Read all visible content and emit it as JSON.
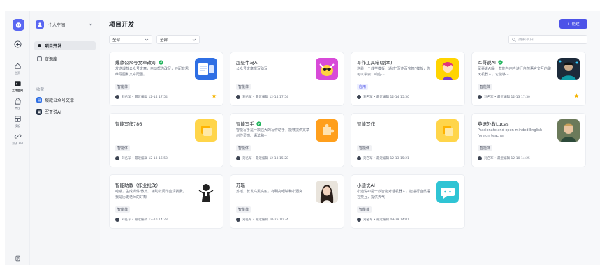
{
  "colors": {
    "brand": "#4d53e8",
    "accent_logo": "#5a67f2",
    "star": "#f5b400",
    "verified": "#1fb45a"
  },
  "rail": {
    "items": [
      {
        "label": "",
        "icon": "plus-circle-icon"
      },
      {
        "label": "主页",
        "icon": "home-icon"
      },
      {
        "label": "工作空间",
        "icon": "folder-icon",
        "active": true
      },
      {
        "label": "商店",
        "icon": "store-icon"
      },
      {
        "label": "模板",
        "icon": "template-icon"
      },
      {
        "label": "扣子 API",
        "icon": "link-icon"
      }
    ]
  },
  "workspace": {
    "name": "个人空间"
  },
  "sidebar": {
    "items": [
      {
        "label": "项目开发",
        "active": true
      },
      {
        "label": "资源库"
      }
    ],
    "group_label": "收藏",
    "favorites": [
      {
        "label": "爆款公众号文章···"
      },
      {
        "label": "军哥说AI"
      }
    ]
  },
  "main": {
    "title": "项目开发",
    "create_label": "+ 创建",
    "filters": [
      {
        "value": "全部"
      },
      {
        "value": "全部"
      }
    ],
    "search_placeholder": "搜索项目"
  },
  "cards": [
    {
      "title": "爆款公众号文章改写",
      "verified": true,
      "desc": "发送爆款公众号文章，自动帮你改写，还配有思维导图和文章配图。",
      "tag": "智能体",
      "meta": "刘名军 • 最近编辑 12-14 17:54",
      "thumb": "doc-thumb",
      "starred": true
    },
    {
      "title": "超级牛马AI",
      "verified": false,
      "desc": "公众号文章撰写助写",
      "tag": "智能体",
      "meta": "刘名军 • 最近编辑 12-14 17:54",
      "thumb": "ox-thumb",
      "starred": false
    },
    {
      "title": "写作工具箱(副本)",
      "verified": false,
      "desc": "这是一个教学模板，通过“写作百宝箱”模板，你可以学会：响应···",
      "tag": "应用",
      "tag_style": "blue",
      "meta": "刘名军 • 最近编辑 12-14 15:50",
      "thumb": "anime-thumb",
      "starred": false
    },
    {
      "title": "军哥说AI",
      "verified": true,
      "desc": "军哥说AI是一款能与用户进行自然语言交互的聊天机器人。它能够···",
      "tag": "智能体",
      "meta": "刘名军 • 最近编辑 12-13 17:30",
      "thumb": "portrait-thumb",
      "starred": true
    },
    {
      "title": "智能写作786",
      "verified": false,
      "desc": "",
      "tag": "智能体",
      "meta": "刘名军 • 最近编辑 12-13 16:53",
      "thumb": "yellow-square-thumb",
      "starred": false
    },
    {
      "title": "智能写手",
      "verified": true,
      "desc": "智能写手是一款强大的写作助手，能够提供文章创作灵感、语法和···",
      "tag": "智能体",
      "meta": "刘名军 • 最近编辑 12-13 15:28",
      "thumb": "orange-puzzle-thumb",
      "starred": false
    },
    {
      "title": "智能写作",
      "verified": false,
      "desc": "",
      "tag": "智能体",
      "meta": "刘名军 • 最近编辑 12-13 15:21",
      "thumb": "yellow-square-thumb",
      "starred": false
    },
    {
      "title": "英语外教Lucas",
      "verified": false,
      "desc": "Passionate and open-minded English foreign teacher",
      "tag": "智能体",
      "meta": "刘名军 • 最近编辑 12-10 14:25",
      "thumb": "man-thumb",
      "starred": false
    },
    {
      "title": "智能助教（作业批改）",
      "verified": false,
      "desc": "哈喽，生成课件/教案、辅助批阅作业请找我，我是历史老师的好帮···",
      "tag": "智能体",
      "meta": "刘名军 • 最近编辑 12-10 14:23",
      "thumb": "teacher-thumb",
      "starred": false
    },
    {
      "title": "苏瑶",
      "verified": false,
      "desc": "苏瑶，长发乌黑亮丽，有明亮眼睛和小酒窝",
      "tag": "智能体",
      "meta": "刘名军 • 最近编辑 10-25 10:34",
      "thumb": "woman-thumb",
      "starred": false
    },
    {
      "title": "小迪说AI",
      "verified": false,
      "desc": "小迪说AI是一款智能对话机器人，能进行自然语言交互，提供天气···",
      "tag": "智能体",
      "meta": "刘名军 • 最近编辑 09-29 14:01",
      "thumb": "chat-thumb",
      "starred": false
    }
  ]
}
